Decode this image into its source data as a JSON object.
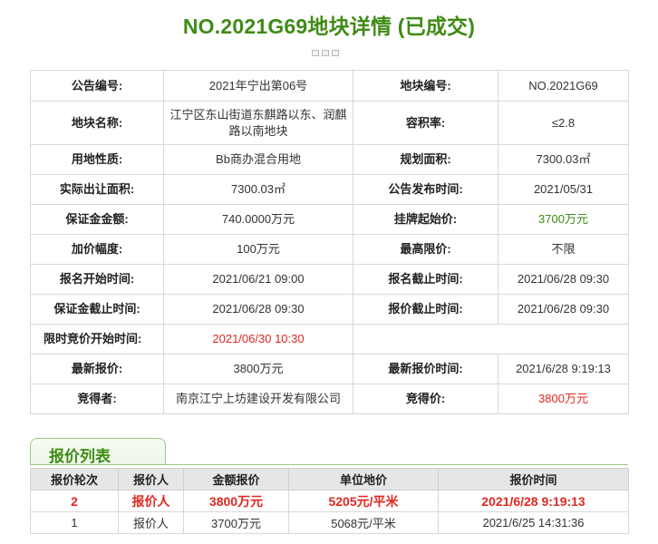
{
  "page": {
    "title": "NO.2021G69地块详情 (已成交)"
  },
  "details": [
    [
      {
        "label": "公告编号:",
        "value": "2021年宁出第06号"
      },
      {
        "label": "地块编号:",
        "value": "NO.2021G69"
      }
    ],
    [
      {
        "label": "地块名称:",
        "value": "江宁区东山街道东麒路以东、润麒路以南地块"
      },
      {
        "label": "容积率:",
        "value": "≤2.8"
      }
    ],
    [
      {
        "label": "用地性质:",
        "value": "Bb商办混合用地"
      },
      {
        "label": "规划面积:",
        "value": "7300.03㎡"
      }
    ],
    [
      {
        "label": "实际出让面积:",
        "value": "7300.03㎡"
      },
      {
        "label": "公告发布时间:",
        "value": "2021/05/31"
      }
    ],
    [
      {
        "label": "保证金金额:",
        "value": "740.0000万元"
      },
      {
        "label": "挂牌起始价:",
        "value": "3700万元",
        "color": "green"
      }
    ],
    [
      {
        "label": "加价幅度:",
        "value": "100万元"
      },
      {
        "label": "最高限价:",
        "value": "不限"
      }
    ],
    [
      {
        "label": "报名开始时间:",
        "value": "2021/06/21 09:00"
      },
      {
        "label": "报名截止时间:",
        "value": "2021/06/28 09:30"
      }
    ],
    [
      {
        "label": "保证金截止时间:",
        "value": "2021/06/28 09:30"
      },
      {
        "label": "报价截止时间:",
        "value": "2021/06/28 09:30"
      }
    ],
    [
      {
        "label": "限时竞价开始时间:",
        "value": "2021/06/30 10:30",
        "color": "red"
      }
    ],
    [
      {
        "label": "最新报价:",
        "value": "3800万元"
      },
      {
        "label": "最新报价时间:",
        "value": "2021/6/28 9:19:13"
      }
    ],
    [
      {
        "label": "竞得者:",
        "value": "南京江宁上坊建设开发有限公司"
      },
      {
        "label": "竞得价:",
        "value": "3800万元",
        "color": "red"
      }
    ]
  ],
  "bid_list": {
    "title": "报价列表",
    "headers": [
      "报价轮次",
      "报价人",
      "金额报价",
      "单位地价",
      "报价时间"
    ],
    "rows": [
      {
        "round": "2",
        "bidder": "报价人",
        "amount": "3800万元",
        "unit_price": "5205元/平米",
        "time": "2021/6/28 9:19:13",
        "highlight": true
      },
      {
        "round": "1",
        "bidder": "报价人",
        "amount": "3700万元",
        "unit_price": "5068元/平米",
        "time": "2021/6/25 14:31:36",
        "highlight": false
      }
    ]
  }
}
